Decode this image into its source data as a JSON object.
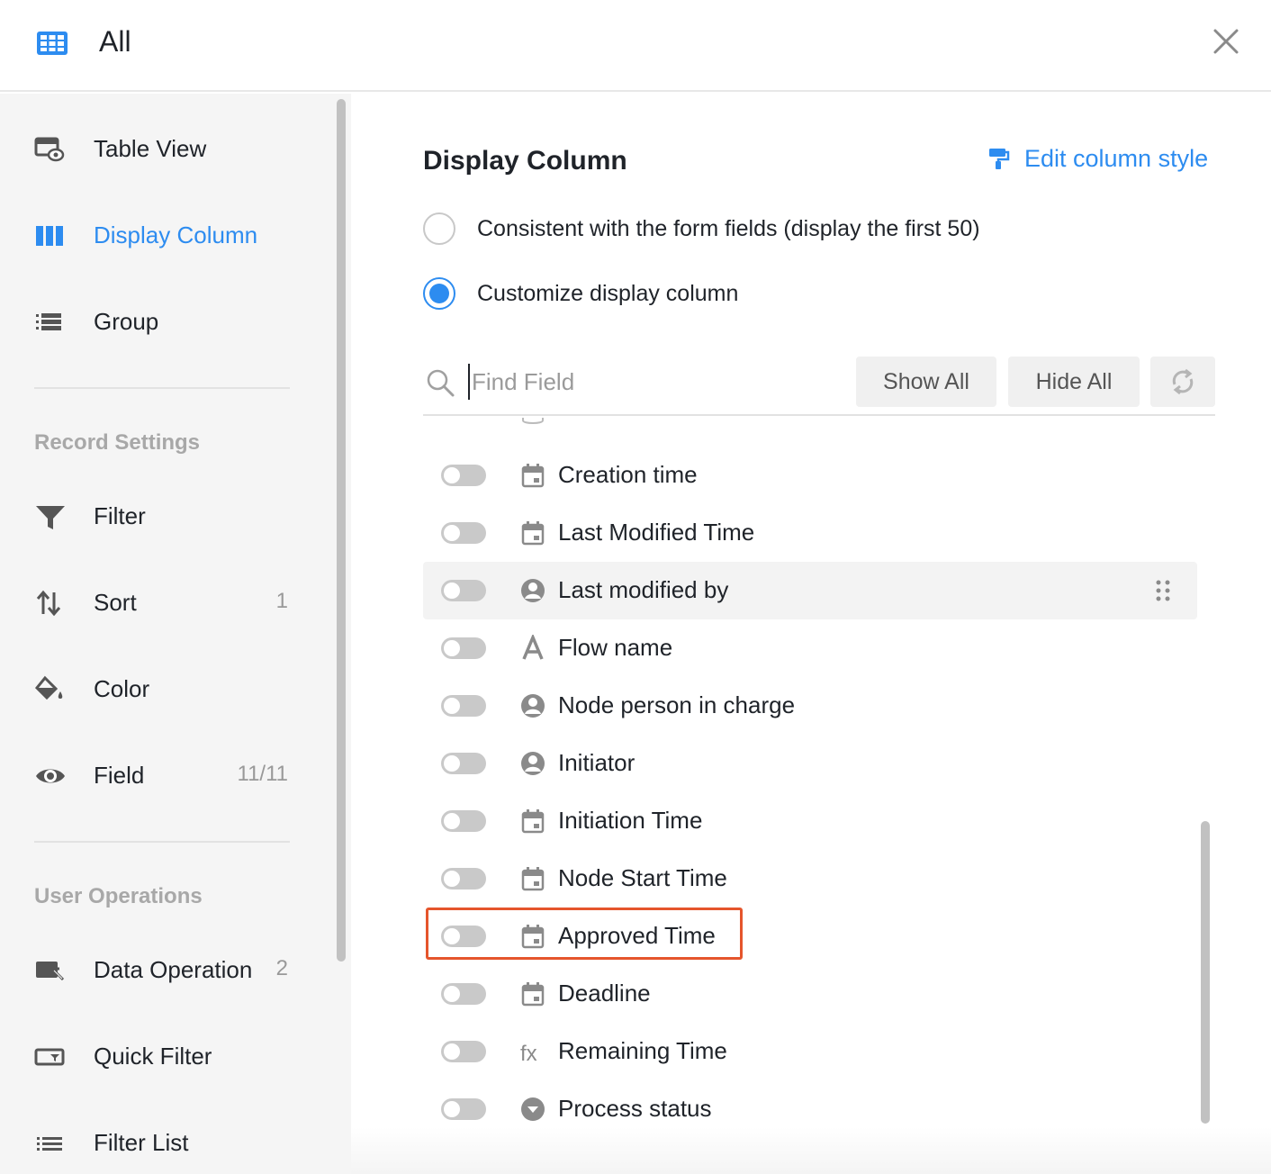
{
  "header": {
    "title": "All"
  },
  "sidebar": {
    "items": [
      {
        "label": "Table View"
      },
      {
        "label": "Display Column"
      },
      {
        "label": "Group"
      }
    ],
    "record_settings": {
      "title": "Record Settings",
      "items": [
        {
          "label": "Filter",
          "count": ""
        },
        {
          "label": "Sort",
          "count": "1"
        },
        {
          "label": "Color",
          "count": ""
        },
        {
          "label": "Field",
          "count": "11/11"
        }
      ]
    },
    "user_operations": {
      "title": "User Operations",
      "items": [
        {
          "label": "Data Operation",
          "count": "2"
        },
        {
          "label": "Quick Filter",
          "count": ""
        },
        {
          "label": "Filter List",
          "count": ""
        }
      ]
    }
  },
  "main": {
    "title": "Display Column",
    "edit_style_label": "Edit column style",
    "options": [
      {
        "label": "Consistent with the form fields (display the first 50)",
        "checked": false
      },
      {
        "label": "Customize display column",
        "checked": true
      }
    ],
    "search": {
      "placeholder": "Find Field"
    },
    "show_all_label": "Show All",
    "hide_all_label": "Hide All",
    "fields": [
      {
        "name": "Creation time",
        "type": "calendar-icon",
        "enabled": false
      },
      {
        "name": "Last Modified Time",
        "type": "calendar-icon",
        "enabled": false
      },
      {
        "name": "Last modified by",
        "type": "user-icon",
        "enabled": false
      },
      {
        "name": "Flow name",
        "type": "text-icon",
        "enabled": false
      },
      {
        "name": "Node person in charge",
        "type": "user-icon",
        "enabled": false
      },
      {
        "name": "Initiator",
        "type": "user-icon",
        "enabled": false
      },
      {
        "name": "Initiation Time",
        "type": "calendar-icon",
        "enabled": false
      },
      {
        "name": "Node Start Time",
        "type": "calendar-icon",
        "enabled": false
      },
      {
        "name": "Approved Time",
        "type": "calendar-icon",
        "enabled": false
      },
      {
        "name": "Deadline",
        "type": "calendar-icon",
        "enabled": false
      },
      {
        "name": "Remaining Time",
        "type": "formula-icon",
        "enabled": false
      },
      {
        "name": "Process status",
        "type": "dropdown-icon",
        "enabled": false
      }
    ]
  }
}
